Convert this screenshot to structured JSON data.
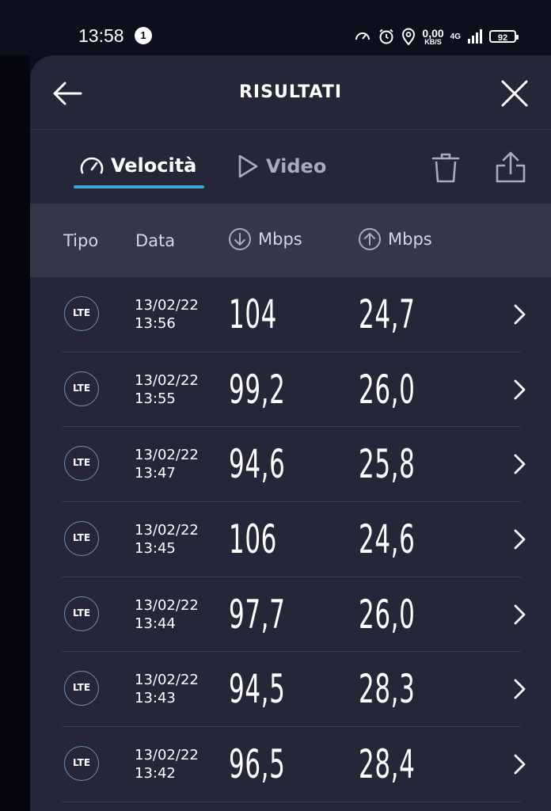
{
  "status": {
    "time": "13:58",
    "notification_count": "1",
    "net_speed_value": "0,00",
    "net_speed_unit": "KB/S",
    "network": "4G",
    "battery": "92"
  },
  "header": {
    "title": "RISULTATI"
  },
  "tabs": [
    {
      "label": "Velocità",
      "icon": "speedometer-icon",
      "active": true
    },
    {
      "label": "Video",
      "icon": "play-icon",
      "active": false
    }
  ],
  "columns": {
    "type": "Tipo",
    "date": "Data",
    "download": "Mbps",
    "upload": "Mbps"
  },
  "rows": [
    {
      "type": "LTE",
      "date": "13/02/22",
      "time": "13:56",
      "download": "104",
      "upload": "24,7"
    },
    {
      "type": "LTE",
      "date": "13/02/22",
      "time": "13:55",
      "download": "99,2",
      "upload": "26,0"
    },
    {
      "type": "LTE",
      "date": "13/02/22",
      "time": "13:47",
      "download": "94,6",
      "upload": "25,8"
    },
    {
      "type": "LTE",
      "date": "13/02/22",
      "time": "13:45",
      "download": "106",
      "upload": "24,6"
    },
    {
      "type": "LTE",
      "date": "13/02/22",
      "time": "13:44",
      "download": "97,7",
      "upload": "26,0"
    },
    {
      "type": "LTE",
      "date": "13/02/22",
      "time": "13:43",
      "download": "94,5",
      "upload": "28,3"
    },
    {
      "type": "LTE",
      "date": "13/02/22",
      "time": "13:42",
      "download": "96,5",
      "upload": "28,4"
    }
  ],
  "colors": {
    "accent": "#3aa7d8",
    "sheet": "#252638",
    "column_header": "#353649"
  }
}
